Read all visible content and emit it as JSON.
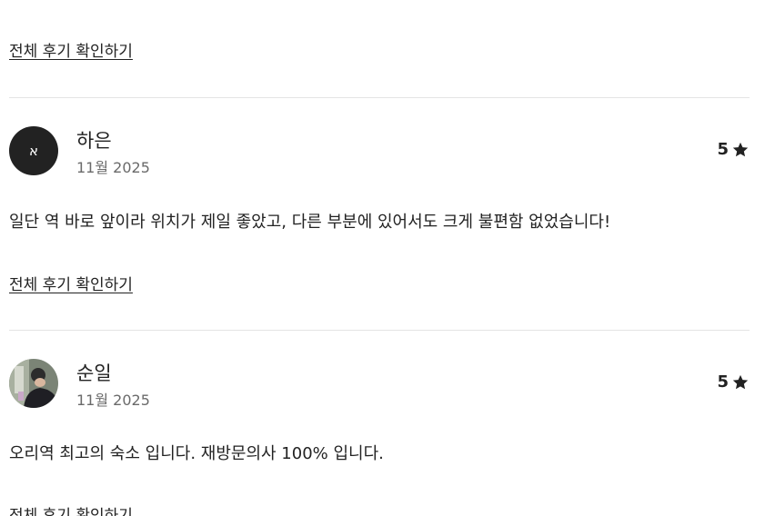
{
  "reviews_link_label": "전체 후기 확인하기",
  "reviews": [
    {
      "avatar_initial": "א",
      "name": "하은",
      "date": "11월 2025",
      "rating": "5",
      "comment": "일단 역 바로 앞이라 위치가 제일 좋았고, 다른 부분에 있어서도 크게 불편함 없었습니다!",
      "link_label": "전체 후기 확인하기"
    },
    {
      "avatar_initial": "",
      "name": "순일",
      "date": "11월 2025",
      "rating": "5",
      "comment": "오리역 최고의 숙소 입니다. 재방문의사 100% 입니다.",
      "link_label": "전체 후기 확인하기"
    }
  ],
  "icons": {
    "rating": "star-icon"
  }
}
